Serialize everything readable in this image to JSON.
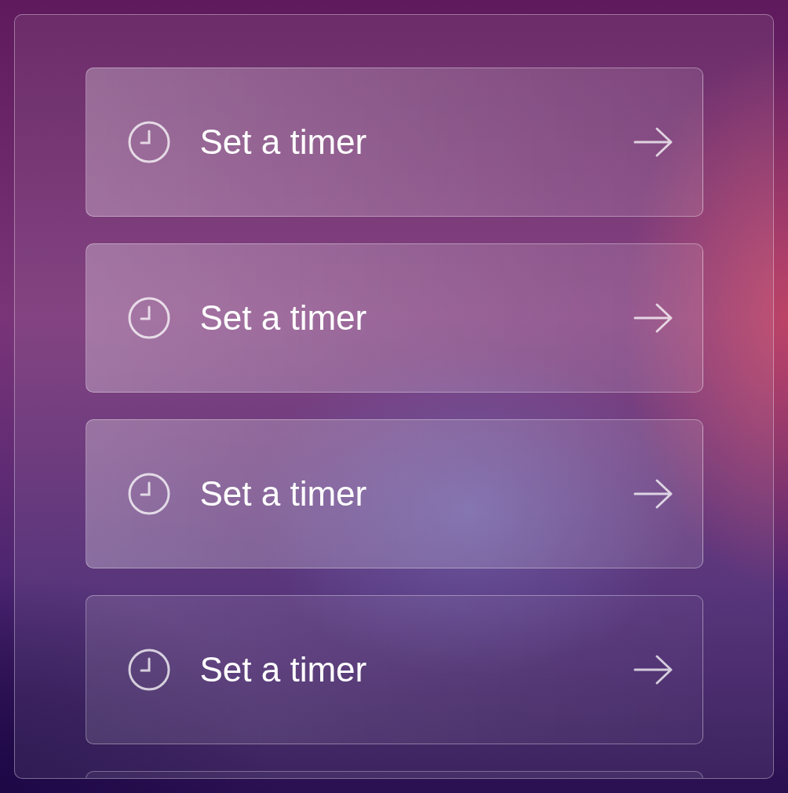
{
  "items": [
    {
      "label": "Set a timer"
    },
    {
      "label": "Set a timer"
    },
    {
      "label": "Set a timer"
    },
    {
      "label": "Set a timer"
    }
  ]
}
